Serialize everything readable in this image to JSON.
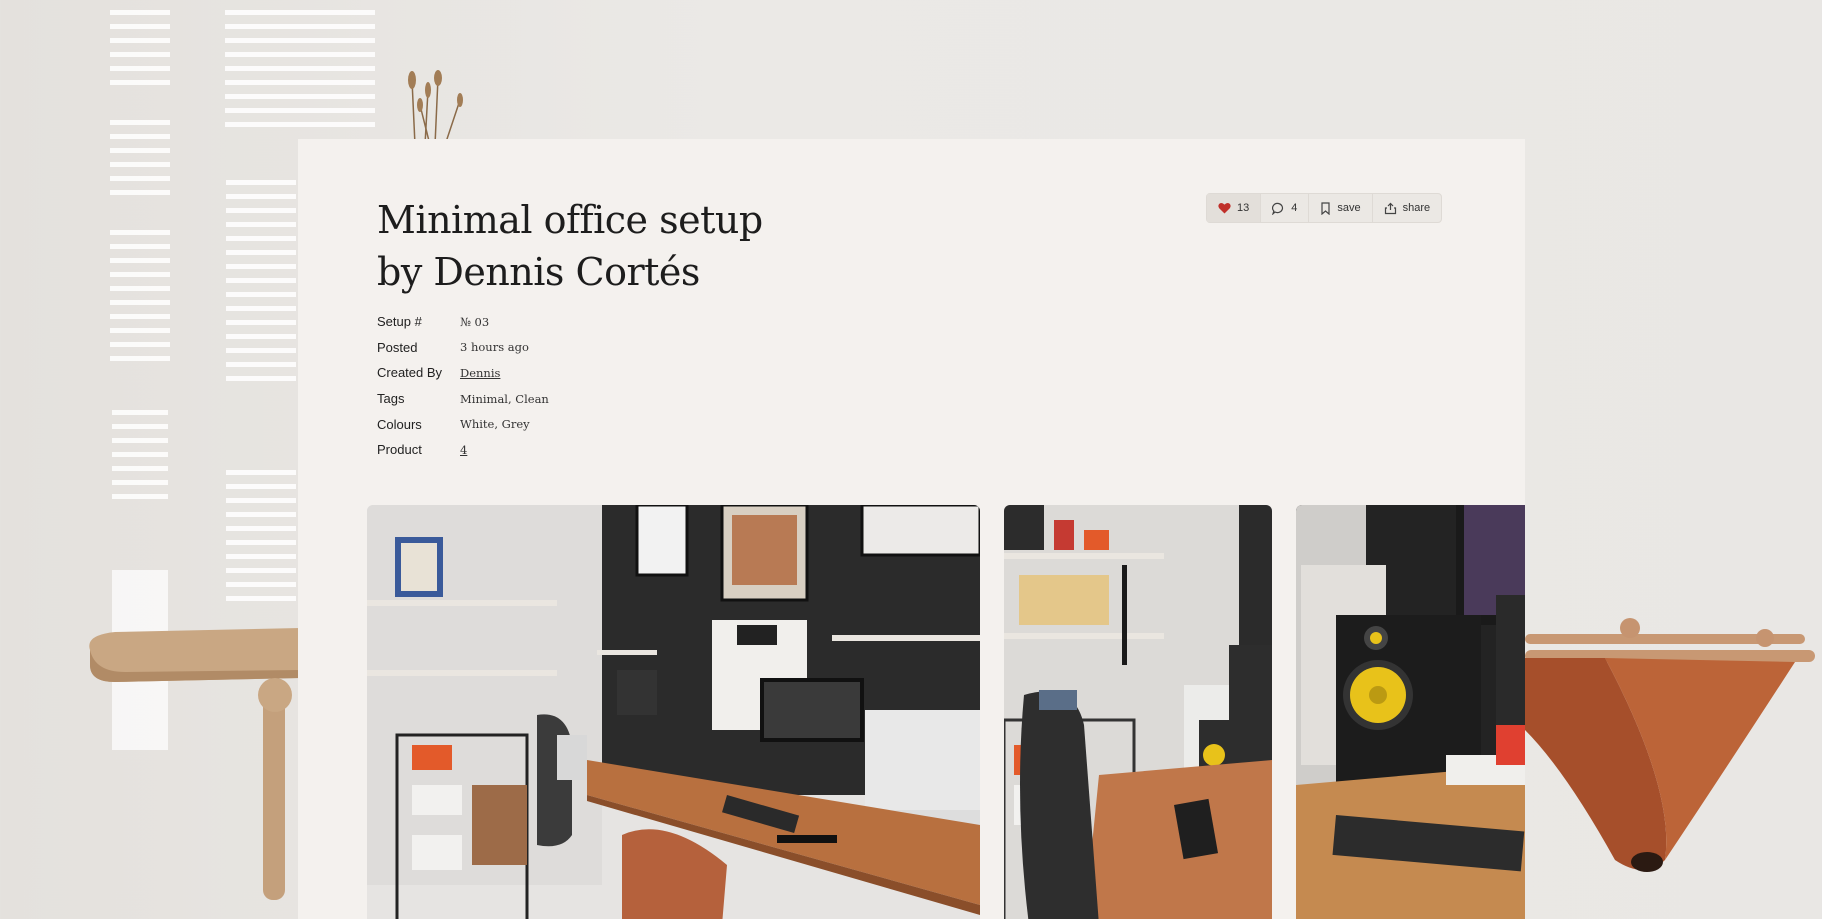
{
  "post": {
    "title_line1": "Minimal office setup",
    "title_line2": "by Dennis Cortés"
  },
  "actions": {
    "likes": "13",
    "comments": "4",
    "save": "save",
    "share": "share"
  },
  "meta": [
    {
      "label": "Setup #",
      "value": "№ 03"
    },
    {
      "label": "Posted",
      "value": "3 hours ago"
    },
    {
      "label": "Created By",
      "value": "Dennis"
    },
    {
      "label": "Tags",
      "value": "Minimal, Clean"
    },
    {
      "label": "Colours",
      "value": "White, Grey"
    },
    {
      "label": "Product",
      "value": "4"
    }
  ],
  "colors": {
    "card_bg": "#f4f1ee",
    "heart": "#c0302a",
    "desk_wood": "#b8703f",
    "wall_black": "#2a2a2a",
    "speaker_yellow": "#e8c21a"
  },
  "icons": [
    "heart-icon",
    "comment-icon",
    "bookmark-icon",
    "share-icon"
  ]
}
